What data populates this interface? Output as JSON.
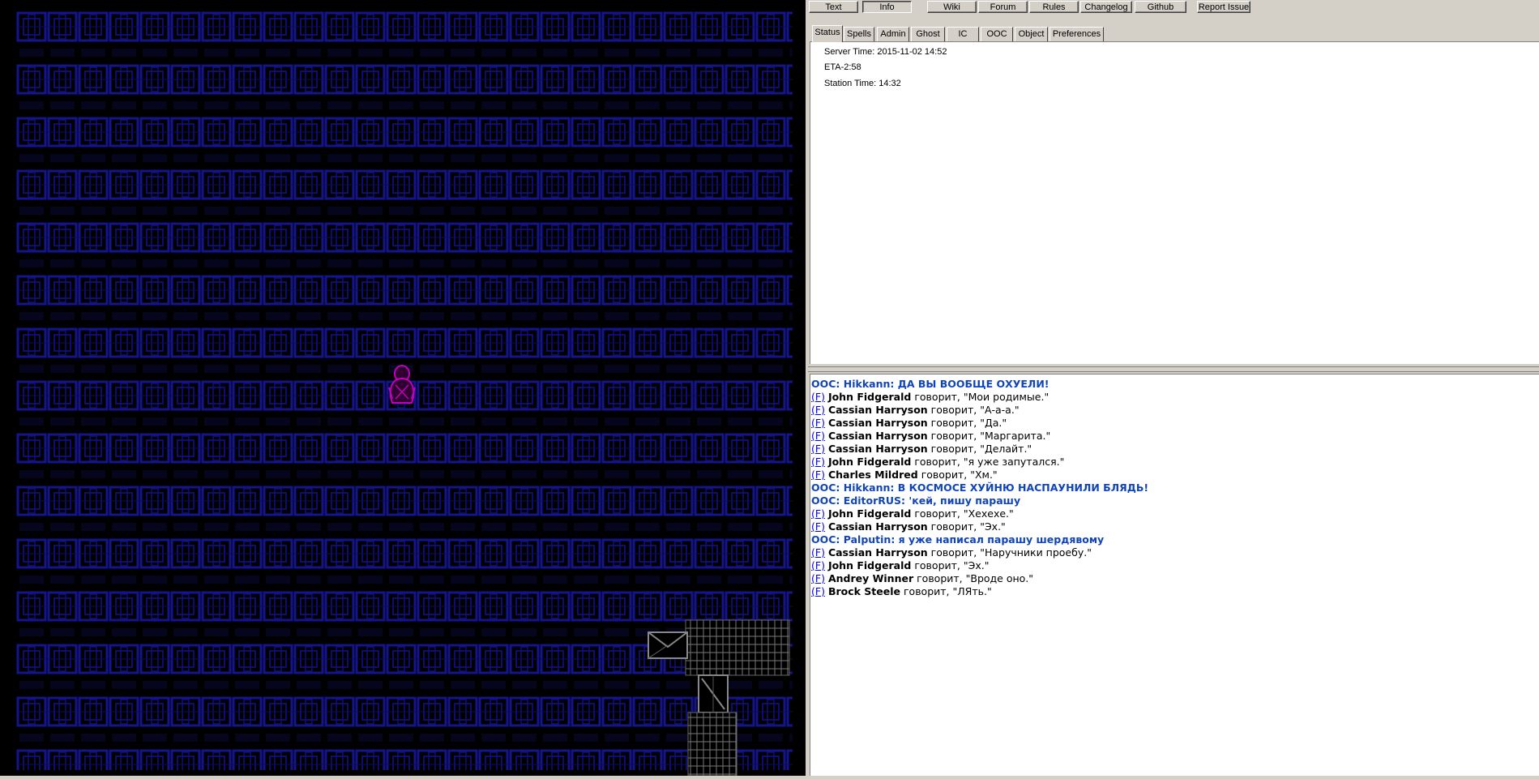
{
  "colors": {
    "map_bg": "#000000",
    "space_tile": "#12128a",
    "player": "#c000c0",
    "station": "#7a7a7a",
    "ooc_text": "#1045b8",
    "flink": "#0000ee"
  },
  "toolbar": {
    "buttons": [
      "Text",
      "Info",
      "Wiki",
      "Forum",
      "Rules",
      "Changelog",
      "Github",
      "Report Issue"
    ]
  },
  "tabs": [
    "Status",
    "Spells",
    "Admin",
    "Ghost",
    "IC",
    "OOC",
    "Object",
    "Preferences"
  ],
  "status": {
    "server_time": "Server Time: 2015-11-02 14:52",
    "eta": "ETA-2:58",
    "station_time": "Station Time: 14:32"
  },
  "chat": {
    "flink": "(F)",
    "verb": " говорит, ",
    "lines": [
      {
        "type": "ooc",
        "text": "OOC: Hikkann: ДА ВЫ ВООБЩЕ ОХУЕЛИ!"
      },
      {
        "type": "say",
        "speaker": "John Fidgerald",
        "quote": "\"Мои родимые.\""
      },
      {
        "type": "say",
        "speaker": "Cassian Harryson",
        "quote": "\"А-а-а.\""
      },
      {
        "type": "say",
        "speaker": "Cassian Harryson",
        "quote": "\"Да.\""
      },
      {
        "type": "say",
        "speaker": "Cassian Harryson",
        "quote": "\"Маргарита.\""
      },
      {
        "type": "say",
        "speaker": "Cassian Harryson",
        "quote": "\"Делайт.\""
      },
      {
        "type": "say",
        "speaker": "John Fidgerald",
        "quote": "\"я уже запутался.\""
      },
      {
        "type": "say",
        "speaker": "Charles Mildred",
        "quote": "\"Хм.\""
      },
      {
        "type": "ooc",
        "text": "OOC: Hikkann: В КОСМОСЕ ХУЙНЮ НАСПАУНИЛИ БЛЯДЬ!"
      },
      {
        "type": "ooc",
        "text": "OOC: EditorRUS: 'кей, пишу парашу"
      },
      {
        "type": "say",
        "speaker": "John Fidgerald",
        "quote": "\"Хехехе.\""
      },
      {
        "type": "say",
        "speaker": "Cassian Harryson",
        "quote": "\"Эх.\""
      },
      {
        "type": "ooc",
        "text": "OOC: Palputin: я уже написал парашу шердявому"
      },
      {
        "type": "say",
        "speaker": "Cassian Harryson",
        "quote": "\"Наручники проебу.\""
      },
      {
        "type": "say",
        "speaker": "John Fidgerald",
        "quote": "\"Эх.\""
      },
      {
        "type": "say",
        "speaker": "Andrey Winner",
        "quote": "\"Вроде оно.\""
      },
      {
        "type": "say",
        "speaker": "Brock Steele",
        "quote": "\"ЛЯть.\""
      }
    ]
  }
}
